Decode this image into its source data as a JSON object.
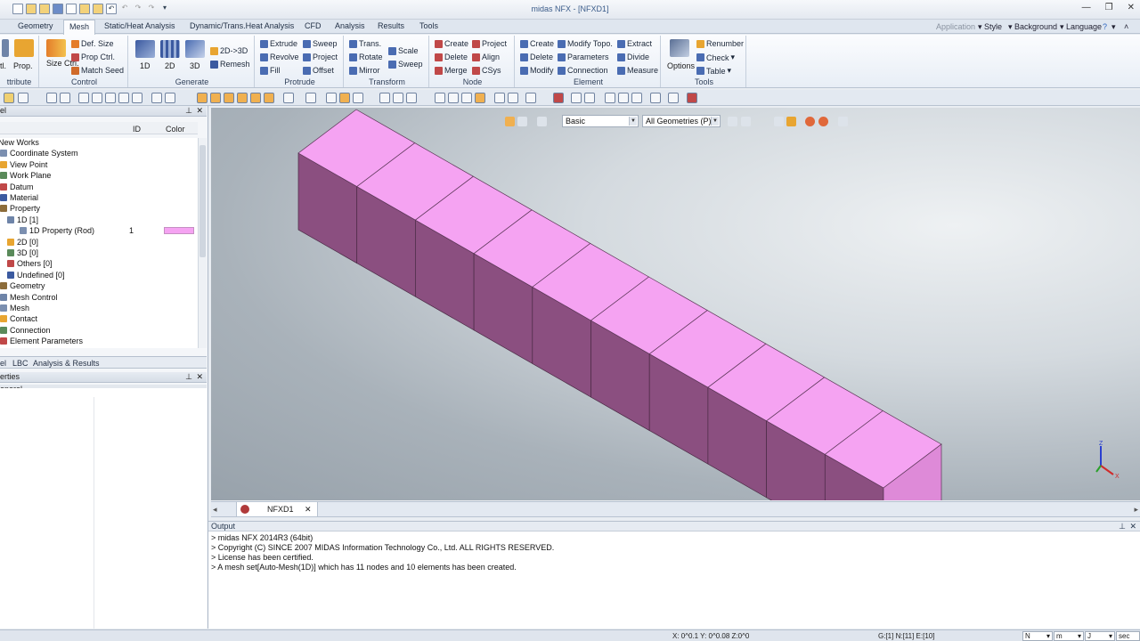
{
  "app": {
    "title": "midas NFX - [NFXD1]"
  },
  "menu": {
    "tabs": [
      "Geometry",
      "Mesh",
      "Static/Heat Analysis",
      "Dynamic/Trans.Heat Analysis",
      "CFD",
      "Analysis",
      "Results",
      "Tools"
    ],
    "active": "Mesh",
    "right": {
      "application": "Application",
      "style": "Style",
      "background": "Background",
      "language": "Language"
    }
  },
  "ribbon": {
    "attribute": {
      "label": "ttribute",
      "items": [
        "tl.",
        "Prop."
      ]
    },
    "control": {
      "label": "Control",
      "size_ctrl": "Size Ctrl.",
      "def_size": "Def. Size",
      "prop_ctrl": "Prop Ctrl.",
      "match_seed": "Match Seed"
    },
    "generate": {
      "label": "Generate",
      "b1d": "1D",
      "b2d": "2D",
      "b3d": "3D",
      "two_to_three": "2D->3D",
      "remesh": "Remesh"
    },
    "protrude": {
      "label": "Protrude",
      "extrude": "Extrude",
      "revolve": "Revolve",
      "fill": "Fill",
      "sweep": "Sweep",
      "project": "Project",
      "offset": "Offset"
    },
    "transform": {
      "label": "Transform",
      "trans": "Trans.",
      "rotate": "Rotate",
      "mirror": "Mirror",
      "scale": "Scale",
      "sweep": "Sweep"
    },
    "node": {
      "label": "Node",
      "create": "Create",
      "delete": "Delete",
      "merge": "Merge",
      "project": "Project",
      "align": "Align",
      "csys": "CSys"
    },
    "element": {
      "label": "Element",
      "create": "Create",
      "delete": "Delete",
      "modify": "Modify",
      "modify_topo": "Modify Topo.",
      "parameters": "Parameters",
      "connection": "Connection",
      "extract": "Extract",
      "divide": "Divide",
      "measure": "Measure"
    },
    "tools": {
      "label": "Tools",
      "options": "Options",
      "renumber": "Renumber",
      "check": "Check",
      "table": "Table"
    }
  },
  "left_panel": {
    "header": "el",
    "columns": {
      "id": "ID",
      "color": "Color"
    },
    "tree": [
      {
        "label": "New Works",
        "indent": 0
      },
      {
        "label": "Coordinate System",
        "indent": 1
      },
      {
        "label": "View Point",
        "indent": 1
      },
      {
        "label": "Work Plane",
        "indent": 1
      },
      {
        "label": "Datum",
        "indent": 1
      },
      {
        "label": "Material",
        "indent": 1
      },
      {
        "label": "Property",
        "indent": 1
      },
      {
        "label": "1D [1]",
        "indent": 2
      },
      {
        "label": "1D Property (Rod)",
        "indent": 3,
        "id": "1",
        "color": "#f5a3f2"
      },
      {
        "label": "2D [0]",
        "indent": 2
      },
      {
        "label": "3D [0]",
        "indent": 2
      },
      {
        "label": "Others [0]",
        "indent": 2
      },
      {
        "label": "Undefined [0]",
        "indent": 2
      },
      {
        "label": "Geometry",
        "indent": 1
      },
      {
        "label": "Mesh Control",
        "indent": 1
      },
      {
        "label": "Mesh",
        "indent": 1
      },
      {
        "label": "Contact",
        "indent": 1
      },
      {
        "label": "Connection",
        "indent": 1
      },
      {
        "label": "Element Parameters",
        "indent": 1
      }
    ],
    "bottom_tabs": [
      "el",
      "LBC",
      "Analysis & Results"
    ],
    "properties": {
      "header": "erties",
      "section": "eneral"
    }
  },
  "viewport": {
    "filter_mode": "Basic",
    "geometry_filter": "All Geometries (P)",
    "beam_color": "#f5a3f2",
    "beam_side_color": "#8b4f80",
    "elements": 10,
    "axes": {
      "x": "X",
      "z": "Z"
    }
  },
  "doc_tab": {
    "name": "NFXD1"
  },
  "output": {
    "title": "Output",
    "lines": [
      "> midas NFX 2014R3 (64bit)",
      "> Copyright (C) SINCE 2007 MIDAS Information Technology Co., Ltd. ALL RIGHTS RESERVED.",
      "> License has been certified.",
      "> A mesh set[Auto-Mesh(1D)] which has 11 nodes and 10 elements has been created."
    ]
  },
  "status": {
    "coords": "X: 0^0.1 Y: 0^0.08 Z:0^0",
    "counts": "G:[1] N:[11] E:[10]",
    "unit_force": "N",
    "unit_length": "m",
    "unit_energy": "J",
    "unit_time": "sec"
  }
}
